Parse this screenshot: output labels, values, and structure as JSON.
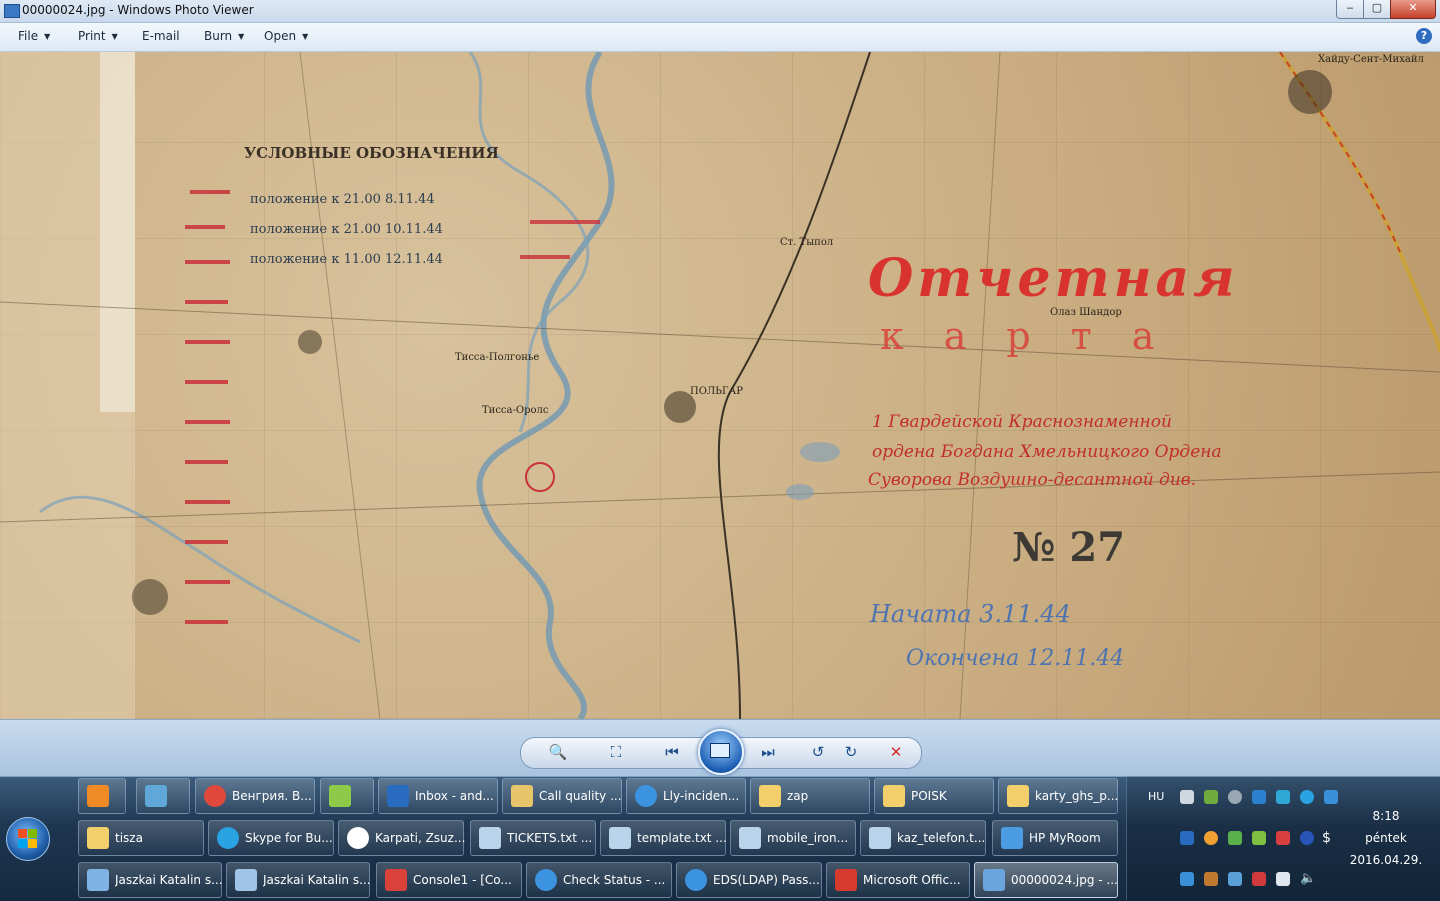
{
  "window": {
    "title": "00000024.jpg - Windows Photo Viewer",
    "controls": {
      "minimize": "‒",
      "maximize": "▢",
      "close": "✕"
    }
  },
  "menu": {
    "items": [
      {
        "label": "File",
        "dropdown": true
      },
      {
        "label": "Print",
        "dropdown": true
      },
      {
        "label": "E-mail",
        "dropdown": false
      },
      {
        "label": "Burn",
        "dropdown": true
      },
      {
        "label": "Open",
        "dropdown": true
      }
    ],
    "help": "?"
  },
  "image": {
    "map_texts": {
      "legend_title": "УСЛОВНЫЕ ОБОЗНАЧЕНИЯ",
      "legend_1": "положение к 21.00 8.11.44",
      "legend_2": "положение к 21.00 10.11.44",
      "legend_3": "положение к 11.00 12.11.44",
      "title_1": "Отчетная",
      "title_2": "карта",
      "unit_1": "1 Гвардейской Краснознаменной",
      "unit_2": "ордена Богдана Хмельницкого Ордена",
      "unit_3": "Суворова Воздушно-десантной див.",
      "number": "№ 27",
      "started": "Начата 3.11.44",
      "ended": "Окончена 12.11.44",
      "town_1": "ПОЛЬГАР",
      "town_2": "Тисса-Полгонье",
      "town_3": "Тисса-Оролс",
      "town_4": "Хайду-Сент-Михайл",
      "town_5": "Олаз Шандор",
      "town_6": "Ст. Тыпол"
    }
  },
  "controlbar": {
    "zoom_icon": "magnifier-icon",
    "fit_icon": "actual-size-icon",
    "prev_icon": "previous-icon",
    "slideshow_icon": "slideshow-icon",
    "next_icon": "next-icon",
    "rotate_ccw_icon": "rotate-counterclockwise-icon",
    "rotate_cw_icon": "rotate-clockwise-icon",
    "delete_icon": "delete-icon"
  },
  "taskbar": {
    "row1": [
      {
        "label": "",
        "icon": "media-player-icon",
        "color": "#f08a24"
      },
      {
        "label": "",
        "icon": "network-lock-icon",
        "color": "#5fa8d8"
      },
      {
        "label": "Венгрия. В...",
        "icon": "chrome-icon",
        "color": "#e0483b"
      },
      {
        "label": "",
        "icon": "pen-tablet-icon",
        "color": "#8ec94a"
      },
      {
        "label": "Inbox - and...",
        "icon": "outlook-icon",
        "color": "#2a6bc2"
      },
      {
        "label": "Call quality ...",
        "icon": "envelope-icon",
        "color": "#e8c46a"
      },
      {
        "label": "Lly-inciden...",
        "icon": "internet-explorer-icon",
        "color": "#3c94e0"
      },
      {
        "label": "zap",
        "icon": "folder-icon",
        "color": "#f2cf6b"
      },
      {
        "label": "POISK",
        "icon": "folder-icon",
        "color": "#f2cf6b"
      },
      {
        "label": "karty_ghs_p...",
        "icon": "folder-icon",
        "color": "#f2cf6b"
      }
    ],
    "row2": [
      {
        "label": "tisza",
        "icon": "folder-icon",
        "color": "#f2cf6b"
      },
      {
        "label": "Skype for Bu...",
        "icon": "skype-icon",
        "color": "#2aa3e2"
      },
      {
        "label": "Karpati, Zsuz...",
        "icon": "chat-icon",
        "color": "#ffffff"
      },
      {
        "label": "TICKETS.txt ...",
        "icon": "notepad-icon",
        "color": "#b9d4ea"
      },
      {
        "label": "template.txt ...",
        "icon": "notepad-icon",
        "color": "#b9d4ea"
      },
      {
        "label": "mobile_iron...",
        "icon": "notepad-icon",
        "color": "#b9d4ea"
      },
      {
        "label": "kaz_telefon.t...",
        "icon": "notepad-icon",
        "color": "#b9d4ea"
      },
      {
        "label": "HP MyRoom",
        "icon": "hp-myroom-icon",
        "color": "#4a9be2"
      }
    ],
    "row3": [
      {
        "label": "Jaszkai Katalin s...",
        "icon": "remote-user-icon",
        "color": "#7fb3e6"
      },
      {
        "label": "Jaszkai Katalin s...",
        "icon": "remote-desktop-icon",
        "color": "#9fc4e8"
      },
      {
        "label": "Console1 - [Co...",
        "icon": "toolbox-icon",
        "color": "#d8423a"
      },
      {
        "label": "Check Status - ...",
        "icon": "internet-explorer-icon",
        "color": "#3c94e0"
      },
      {
        "label": "EDS(LDAP) Pass...",
        "icon": "internet-explorer-icon",
        "color": "#3c94e0"
      },
      {
        "label": "Microsoft Offic...",
        "icon": "office-icon",
        "color": "#d63a2f"
      },
      {
        "label": "00000024.jpg - ...",
        "icon": "photo-viewer-icon",
        "color": "#6aa6dd",
        "active": true
      }
    ]
  },
  "tray": {
    "language": "HU",
    "time": "8:18",
    "day": "péntek",
    "date": "2016.04.29."
  }
}
